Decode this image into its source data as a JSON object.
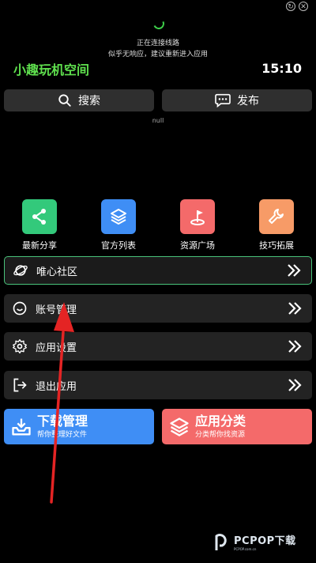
{
  "status": {
    "connecting": "正在连接线路",
    "hint": "似乎无响应，建议重新进入应用"
  },
  "header": {
    "app_title": "小趣玩机空间",
    "time": "15:10"
  },
  "toolbar": {
    "search_label": "搜索",
    "publish_label": "发布"
  },
  "null_text": "null",
  "tiles": [
    {
      "label": "最新分享",
      "color": "#33c97b",
      "icon": "share-icon"
    },
    {
      "label": "官方列表",
      "color": "#3f8ef5",
      "icon": "layers-icon"
    },
    {
      "label": "资源广场",
      "color": "#f46a6a",
      "icon": "flag-icon"
    },
    {
      "label": "技巧拓展",
      "color": "#f79b67",
      "icon": "wrench-icon"
    }
  ],
  "menu": [
    {
      "label": "唯心社区",
      "icon": "planet-icon"
    },
    {
      "label": "账号管理",
      "icon": "smiley-icon"
    },
    {
      "label": "应用设置",
      "icon": "gear-icon"
    },
    {
      "label": "退出应用",
      "icon": "exit-icon"
    }
  ],
  "cards": {
    "download": {
      "title": "下载管理",
      "subtitle": "帮你整理好文件",
      "color": "#3f8ef5"
    },
    "category": {
      "title": "应用分类",
      "subtitle": "分类帮你找资源",
      "color": "#f46a6a"
    }
  },
  "watermark": {
    "text": "PCPOP下载",
    "sub": "PCPOP.com.cn"
  }
}
